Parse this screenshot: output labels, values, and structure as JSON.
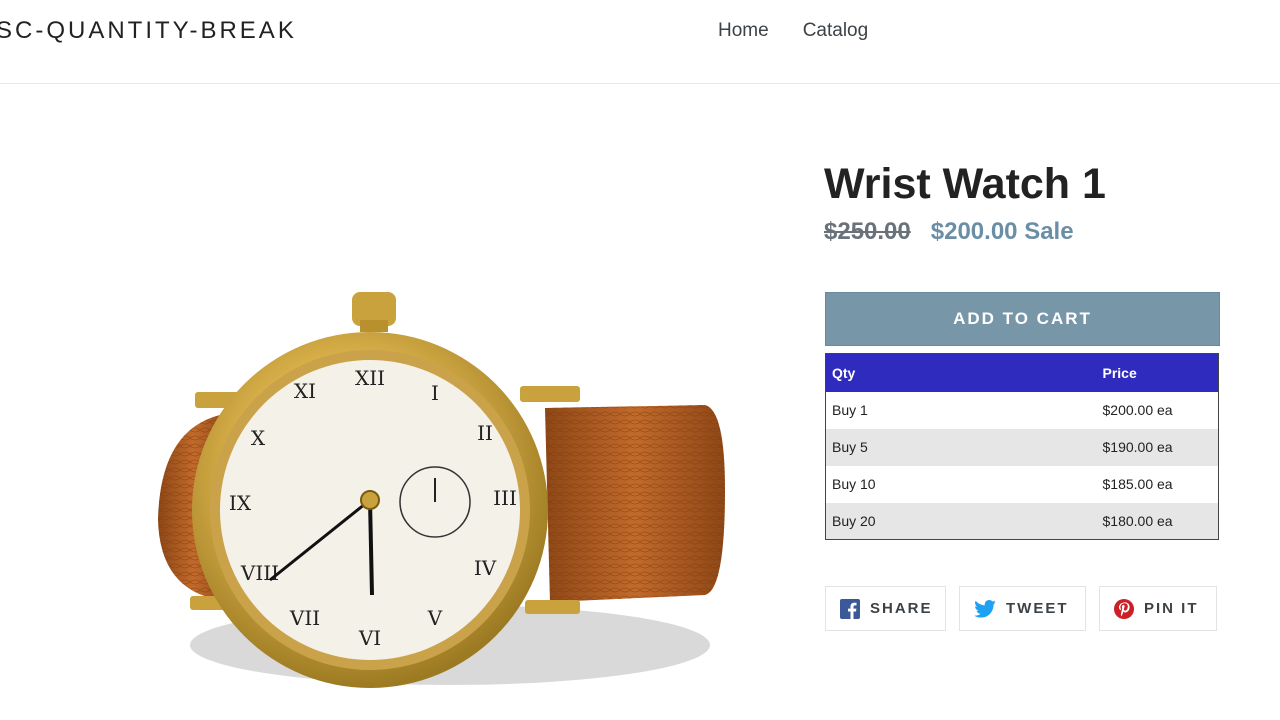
{
  "header": {
    "logo": "SC-QUANTITY-BREAK",
    "nav": [
      "Home",
      "Catalog"
    ]
  },
  "product": {
    "title": "Wrist Watch 1",
    "price_original": "$250.00",
    "price_sale": "$200.00",
    "sale_label": "Sale",
    "add_to_cart": "ADD TO CART",
    "image_icon": "wrist-watch-image"
  },
  "quantity_breaks": {
    "headers": [
      "Qty",
      "Price"
    ],
    "rows": [
      {
        "qty": "Buy 1",
        "price": "$200.00 ea"
      },
      {
        "qty": "Buy 5",
        "price": "$190.00 ea"
      },
      {
        "qty": "Buy 10",
        "price": "$185.00 ea"
      },
      {
        "qty": "Buy 20",
        "price": "$180.00 ea"
      }
    ],
    "header_color": "#2f2bbf"
  },
  "social": {
    "share": "SHARE",
    "tweet": "TWEET",
    "pin": "PIN IT",
    "icons": [
      "facebook-icon",
      "twitter-icon",
      "pinterest-icon"
    ]
  },
  "colors": {
    "accent": "#7796a8",
    "sale_price": "#6a8ea6"
  }
}
